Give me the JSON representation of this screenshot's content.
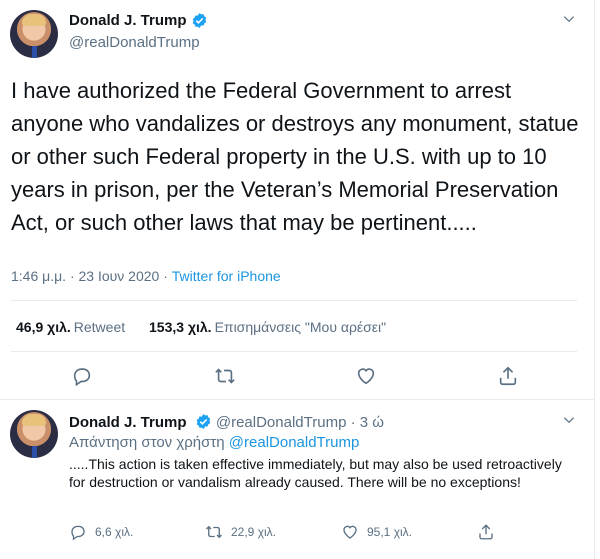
{
  "tweet": {
    "author_name": "Donald J. Trump",
    "author_handle": "@realDonaldTrump",
    "text": "I have authorized the Federal Government to arrest anyone who vandalizes or destroys any monument, statue or other such Federal property in the U.S. with up to 10 years in prison, per the Veteran’s Memorial Preservation Act, or such other laws that may be pertinent.....",
    "timestamp": "1:46 μ.μ. · 23 Ιουν 2020 · ",
    "source": "Twitter for iPhone",
    "retweets_count": "46,9 χιλ.",
    "retweets_label": "Retweet",
    "likes_count": "153,3 χιλ.",
    "likes_label": "Επισημάνσεις \"Μου αρέσει\""
  },
  "reply": {
    "author_name": "Donald J. Trump",
    "author_handle": "@realDonaldTrump",
    "time": "· 3 ώ",
    "replying_to_label": "Απάντηση στον χρήστη ",
    "replying_to_handle": "@realDonaldTrump",
    "text": ".....This action is taken effective immediately, but may also be used retroactively for destruction or vandalism already caused. There will be no exceptions!",
    "reply_count": "6,6 χιλ.",
    "retweet_count": "22,9 χιλ.",
    "like_count": "95,1 χιλ."
  },
  "colors": {
    "accent": "#1b95e0",
    "muted": "#5b7083",
    "text": "#0f1419",
    "border": "#e6ecf0",
    "verified": "#1da1f2"
  },
  "icons": [
    "verified-icon",
    "chevron-down-icon",
    "reply-icon",
    "retweet-icon",
    "like-icon",
    "share-icon"
  ]
}
